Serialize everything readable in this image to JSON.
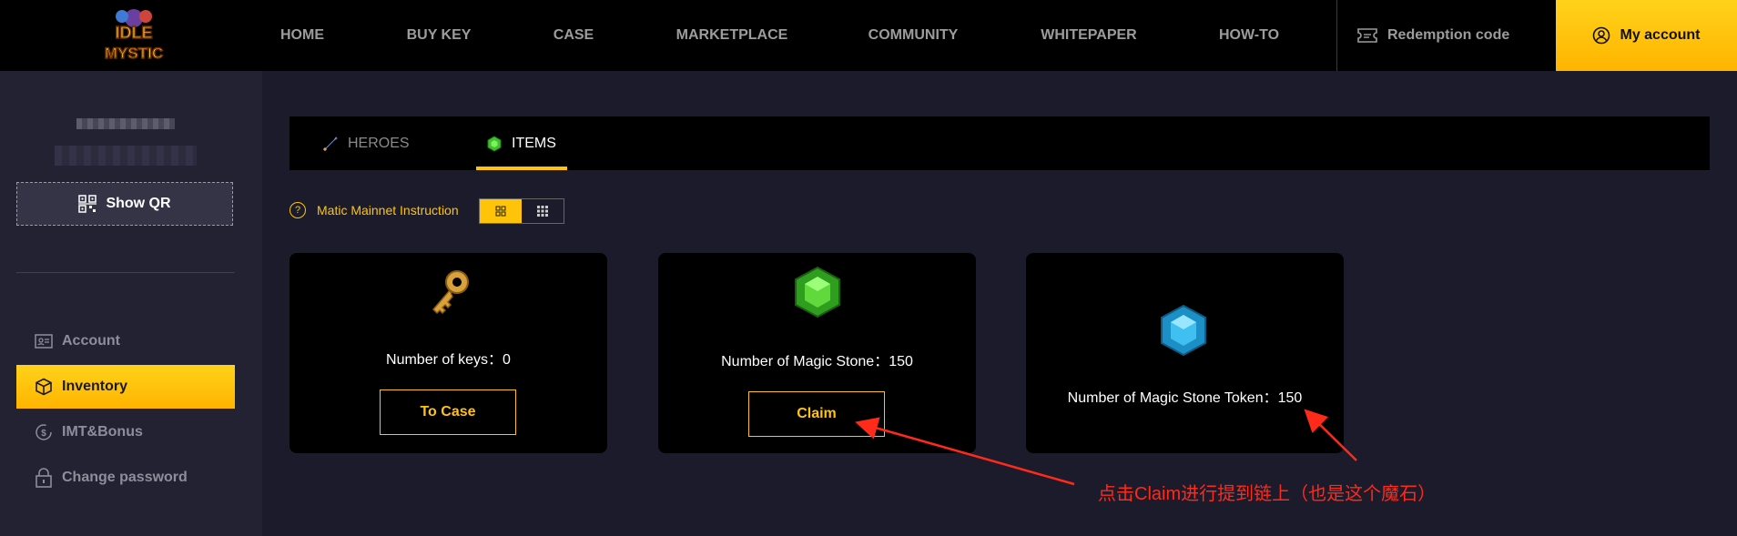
{
  "header": {
    "logo_text": "IDLE MYSTIC",
    "nav": [
      "HOME",
      "BUY KEY",
      "CASE",
      "MARKETPLACE",
      "COMMUNITY",
      "WHITEPAPER",
      "HOW-TO"
    ],
    "redemption_label": "Redemption code",
    "my_account_label": "My account"
  },
  "sidebar": {
    "show_qr_label": "Show QR",
    "items": [
      {
        "label": "Account",
        "icon": "id-card-icon"
      },
      {
        "label": "Inventory",
        "icon": "box-icon"
      },
      {
        "label": "IMT&Bonus",
        "icon": "coin-icon"
      },
      {
        "label": "Change password",
        "icon": "lock-icon"
      }
    ],
    "active": "Inventory"
  },
  "tabs": [
    {
      "label": "HEROES",
      "icon": "sword-icon"
    },
    {
      "label": "ITEMS",
      "icon": "green-gem-icon"
    }
  ],
  "active_tab": "ITEMS",
  "instruction": {
    "icon": "question-icon",
    "label": "Matic Mainnet Instruction"
  },
  "cards": [
    {
      "icon": "key-icon",
      "label": "Number of keys：0",
      "button": "To Case"
    },
    {
      "icon": "green-gem-icon",
      "label": "Number of Magic Stone：150",
      "button": "Claim"
    },
    {
      "icon": "blue-gem-icon",
      "label": "Number of Magic Stone Token：150"
    }
  ],
  "annotation": {
    "text": "点击Claim进行提到链上（也是这个魔石）"
  },
  "colors": {
    "accent": "#ffc40a",
    "background": "#1b1b2b",
    "sidebar": "#222233",
    "annotation": "#ff2a1a"
  }
}
